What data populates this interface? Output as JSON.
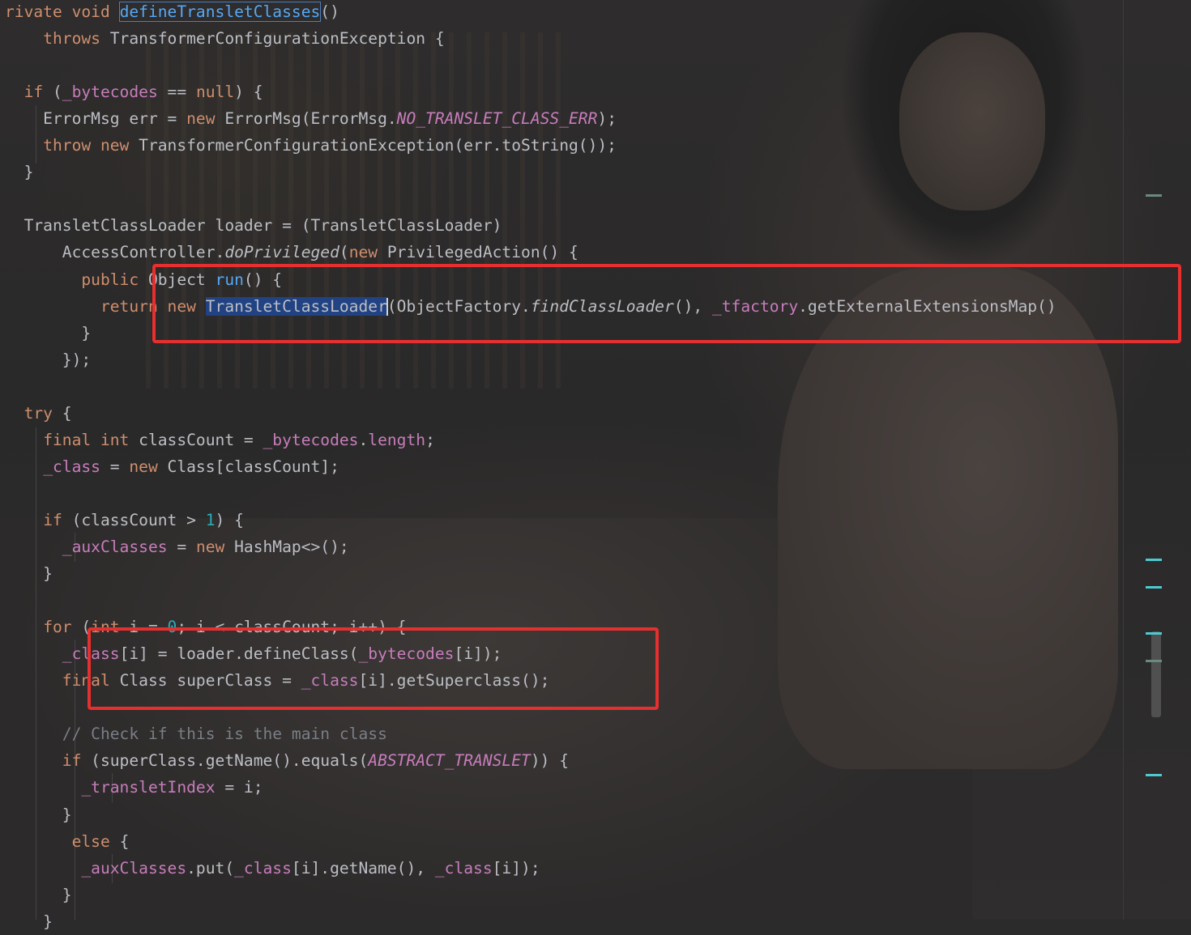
{
  "editor": {
    "lines": [
      {
        "parts": [
          [
            "kw",
            "rivate void "
          ],
          [
            "fn-hl",
            "defineTransletClasses"
          ],
          [
            "",
            "()"
          ]
        ]
      },
      {
        "parts": [
          [
            "",
            "    "
          ],
          [
            "kw",
            "throws "
          ],
          [
            "",
            "TransformerConfigurationException {"
          ]
        ]
      },
      {
        "parts": []
      },
      {
        "parts": [
          [
            "",
            "  "
          ],
          [
            "kw",
            "if "
          ],
          [
            "",
            "("
          ],
          [
            "fld",
            "_bytecodes"
          ],
          [
            "",
            " == "
          ],
          [
            "kw",
            "null"
          ],
          [
            "",
            ") {"
          ]
        ]
      },
      {
        "parts": [
          [
            "",
            "    ErrorMsg err = "
          ],
          [
            "kw",
            "new "
          ],
          [
            "",
            "ErrorMsg(ErrorMsg."
          ],
          [
            "fld-ital",
            "NO_TRANSLET_CLASS_ERR"
          ],
          [
            "",
            ");"
          ]
        ]
      },
      {
        "parts": [
          [
            "",
            "    "
          ],
          [
            "kw",
            "throw new "
          ],
          [
            "",
            "TransformerConfigurationException(err.toString());"
          ]
        ]
      },
      {
        "parts": [
          [
            "",
            "  }"
          ]
        ]
      },
      {
        "parts": []
      },
      {
        "parts": [
          [
            "",
            "  TransletClassLoader loader = (TransletClassLoader)"
          ]
        ]
      },
      {
        "parts": [
          [
            "",
            "      AccessController."
          ],
          [
            "ital",
            "doPrivileged"
          ],
          [
            "",
            "("
          ],
          [
            "kw",
            "new "
          ],
          [
            "",
            "PrivilegedAction() {"
          ]
        ]
      },
      {
        "parts": [
          [
            "",
            "        "
          ],
          [
            "kw",
            "public "
          ],
          [
            "",
            "Object "
          ],
          [
            "fn",
            "run"
          ],
          [
            "",
            "() {"
          ]
        ]
      },
      {
        "parts": [
          [
            "",
            "          "
          ],
          [
            "kw",
            "return new "
          ],
          [
            "sel",
            "TransletClassLoader"
          ],
          [
            "caret",
            ""
          ],
          [
            "",
            "(ObjectFactory."
          ],
          [
            "ital",
            "findClassLoader"
          ],
          [
            "",
            "(), "
          ],
          [
            "fld",
            "_tfactory"
          ],
          [
            "",
            ".getExternalExtensionsMap()"
          ]
        ]
      },
      {
        "parts": [
          [
            "",
            "        }"
          ]
        ]
      },
      {
        "parts": [
          [
            "",
            "      });"
          ]
        ]
      },
      {
        "parts": []
      },
      {
        "parts": [
          [
            "",
            "  "
          ],
          [
            "kw",
            "try "
          ],
          [
            "",
            "{"
          ]
        ]
      },
      {
        "parts": [
          [
            "",
            "    "
          ],
          [
            "kw",
            "final int "
          ],
          [
            "",
            "classCount = "
          ],
          [
            "fld",
            "_bytecodes"
          ],
          [
            "",
            "."
          ],
          [
            "fld",
            "length"
          ],
          [
            "",
            ";"
          ]
        ]
      },
      {
        "parts": [
          [
            "",
            "    "
          ],
          [
            "fld",
            "_class"
          ],
          [
            "",
            " = "
          ],
          [
            "kw",
            "new "
          ],
          [
            "",
            "Class[classCount];"
          ]
        ]
      },
      {
        "parts": []
      },
      {
        "parts": [
          [
            "",
            "    "
          ],
          [
            "kw",
            "if "
          ],
          [
            "",
            "(classCount > "
          ],
          [
            "num",
            "1"
          ],
          [
            "",
            ") {"
          ]
        ]
      },
      {
        "parts": [
          [
            "",
            "      "
          ],
          [
            "fld",
            "_auxClasses"
          ],
          [
            "",
            " = "
          ],
          [
            "kw",
            "new "
          ],
          [
            "",
            "HashMap<>();"
          ]
        ]
      },
      {
        "parts": [
          [
            "",
            "    }"
          ]
        ]
      },
      {
        "parts": []
      },
      {
        "parts": [
          [
            "",
            "    "
          ],
          [
            "kw",
            "for "
          ],
          [
            "",
            "("
          ],
          [
            "kw",
            "int "
          ],
          [
            "",
            "i = "
          ],
          [
            "num",
            "0"
          ],
          [
            "",
            "; i < classCount; i++) {"
          ]
        ]
      },
      {
        "parts": [
          [
            "",
            "      "
          ],
          [
            "fld",
            "_class"
          ],
          [
            "",
            "[i] = loader.defineClass("
          ],
          [
            "fld",
            "_bytecodes"
          ],
          [
            "",
            "[i]);"
          ]
        ]
      },
      {
        "parts": [
          [
            "",
            "      "
          ],
          [
            "kw",
            "final "
          ],
          [
            "",
            "Class superClass = "
          ],
          [
            "fld",
            "_class"
          ],
          [
            "",
            "[i].getSuperclass();"
          ]
        ]
      },
      {
        "parts": []
      },
      {
        "parts": [
          [
            "",
            "      "
          ],
          [
            "cmt",
            "// Check if this is the main class"
          ]
        ]
      },
      {
        "parts": [
          [
            "",
            "      "
          ],
          [
            "kw",
            "if "
          ],
          [
            "",
            "(superClass.getName().equals("
          ],
          [
            "fld-ital",
            "ABSTRACT_TRANSLET"
          ],
          [
            "",
            ")) {"
          ]
        ]
      },
      {
        "parts": [
          [
            "",
            "        "
          ],
          [
            "fld",
            "_transletIndex"
          ],
          [
            "",
            " = i;"
          ]
        ]
      },
      {
        "parts": [
          [
            "",
            "      }"
          ]
        ]
      },
      {
        "parts": [
          [
            "",
            "       "
          ],
          [
            "kw",
            "else "
          ],
          [
            "",
            "{"
          ]
        ]
      },
      {
        "parts": [
          [
            "",
            "        "
          ],
          [
            "fld",
            "_auxClasses"
          ],
          [
            "",
            ".put("
          ],
          [
            "fld",
            "_class"
          ],
          [
            "",
            "[i].getName(), "
          ],
          [
            "fld",
            "_class"
          ],
          [
            "",
            "[i]);"
          ]
        ]
      },
      {
        "parts": [
          [
            "",
            "      }"
          ]
        ]
      },
      {
        "parts": [
          [
            "",
            "    }"
          ]
        ]
      }
    ]
  },
  "colors": {
    "keyword": "#cf8e6d",
    "field": "#c77dbb",
    "function": "#56a8f5",
    "number": "#2aacb8",
    "comment": "#7a7e85",
    "text": "#bcbec4",
    "annotation_box": "#e5302f",
    "gutter_marker_cyan": "#4ec9d0",
    "gutter_marker_gray": "#6a8a80"
  }
}
